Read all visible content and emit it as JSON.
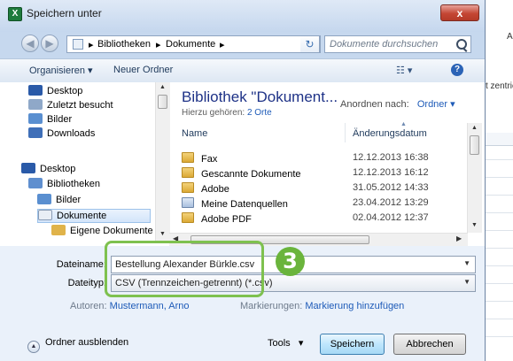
{
  "window": {
    "title": "Speichern unter",
    "app_icon": "X",
    "close_glyph": "x"
  },
  "address": {
    "crumbs": [
      "Bibliotheken",
      "Dokumente"
    ],
    "search_placeholder": "Dokumente durchsuchen"
  },
  "toolbar": {
    "organize": "Organisieren ▾",
    "new_folder": "Neuer Ordner",
    "view_glyph": "☷ ▾",
    "help_glyph": "?"
  },
  "nav": {
    "items": [
      {
        "label": "Desktop",
        "icon": "desktop-icon"
      },
      {
        "label": "Zuletzt besucht",
        "icon": "recent-places-icon"
      },
      {
        "label": "Bilder",
        "icon": "pictures-icon"
      },
      {
        "label": "Downloads",
        "icon": "downloads-icon"
      },
      {
        "label": "Desktop",
        "icon": "desktop-icon"
      },
      {
        "label": "Bibliotheken",
        "icon": "libraries-icon"
      },
      {
        "label": "Bilder",
        "icon": "pictures-icon"
      },
      {
        "label": "Dokumente",
        "icon": "documents-icon"
      },
      {
        "label": "Eigene Dokumente",
        "icon": "folder-icon"
      }
    ]
  },
  "library": {
    "title": "Bibliothek \"Dokument...",
    "subtitle_prefix": "Hierzu gehören:",
    "subtitle_link": "2 Orte",
    "arrange_label": "Anordnen nach:",
    "arrange_value": "Ordner ▾"
  },
  "columns": {
    "name": "Name",
    "date": "Änderungsdatum"
  },
  "files": [
    {
      "name": "Fax",
      "date": "12.12.2013 16:38"
    },
    {
      "name": "Gescannte Dokumente",
      "date": "12.12.2013 16:12"
    },
    {
      "name": "Adobe",
      "date": "31.05.2012 14:33"
    },
    {
      "name": "Meine Datenquellen",
      "date": "23.04.2012 13:29"
    },
    {
      "name": "Adobe PDF",
      "date": "02.04.2012 12:37"
    }
  ],
  "form": {
    "filename_label": "Dateiname:",
    "filename_value": "Bestellung Alexander Bürkle.csv",
    "filetype_label": "Dateityp:",
    "filetype_value": "CSV (Trennzeichen-getrennt) (*.csv)",
    "authors_label": "Autoren:",
    "authors_value": "Mustermann, Arno",
    "tags_label": "Markierungen:",
    "tags_value": "Markierung hinzufügen"
  },
  "annotation": {
    "step_number": "3"
  },
  "footer": {
    "hide_folders": "Ordner ausblenden",
    "tools": "Tools",
    "save": "Speichern",
    "cancel": "Abbrechen"
  },
  "background_app": {
    "col_label": "A",
    "cell_text": "t zentrie"
  },
  "colors": {
    "close_red": "#c44634",
    "highlight_green": "#7ec14f",
    "badge_green": "#6ab43c",
    "link_blue": "#1e5bb8",
    "title_blue": "#1e3287"
  }
}
